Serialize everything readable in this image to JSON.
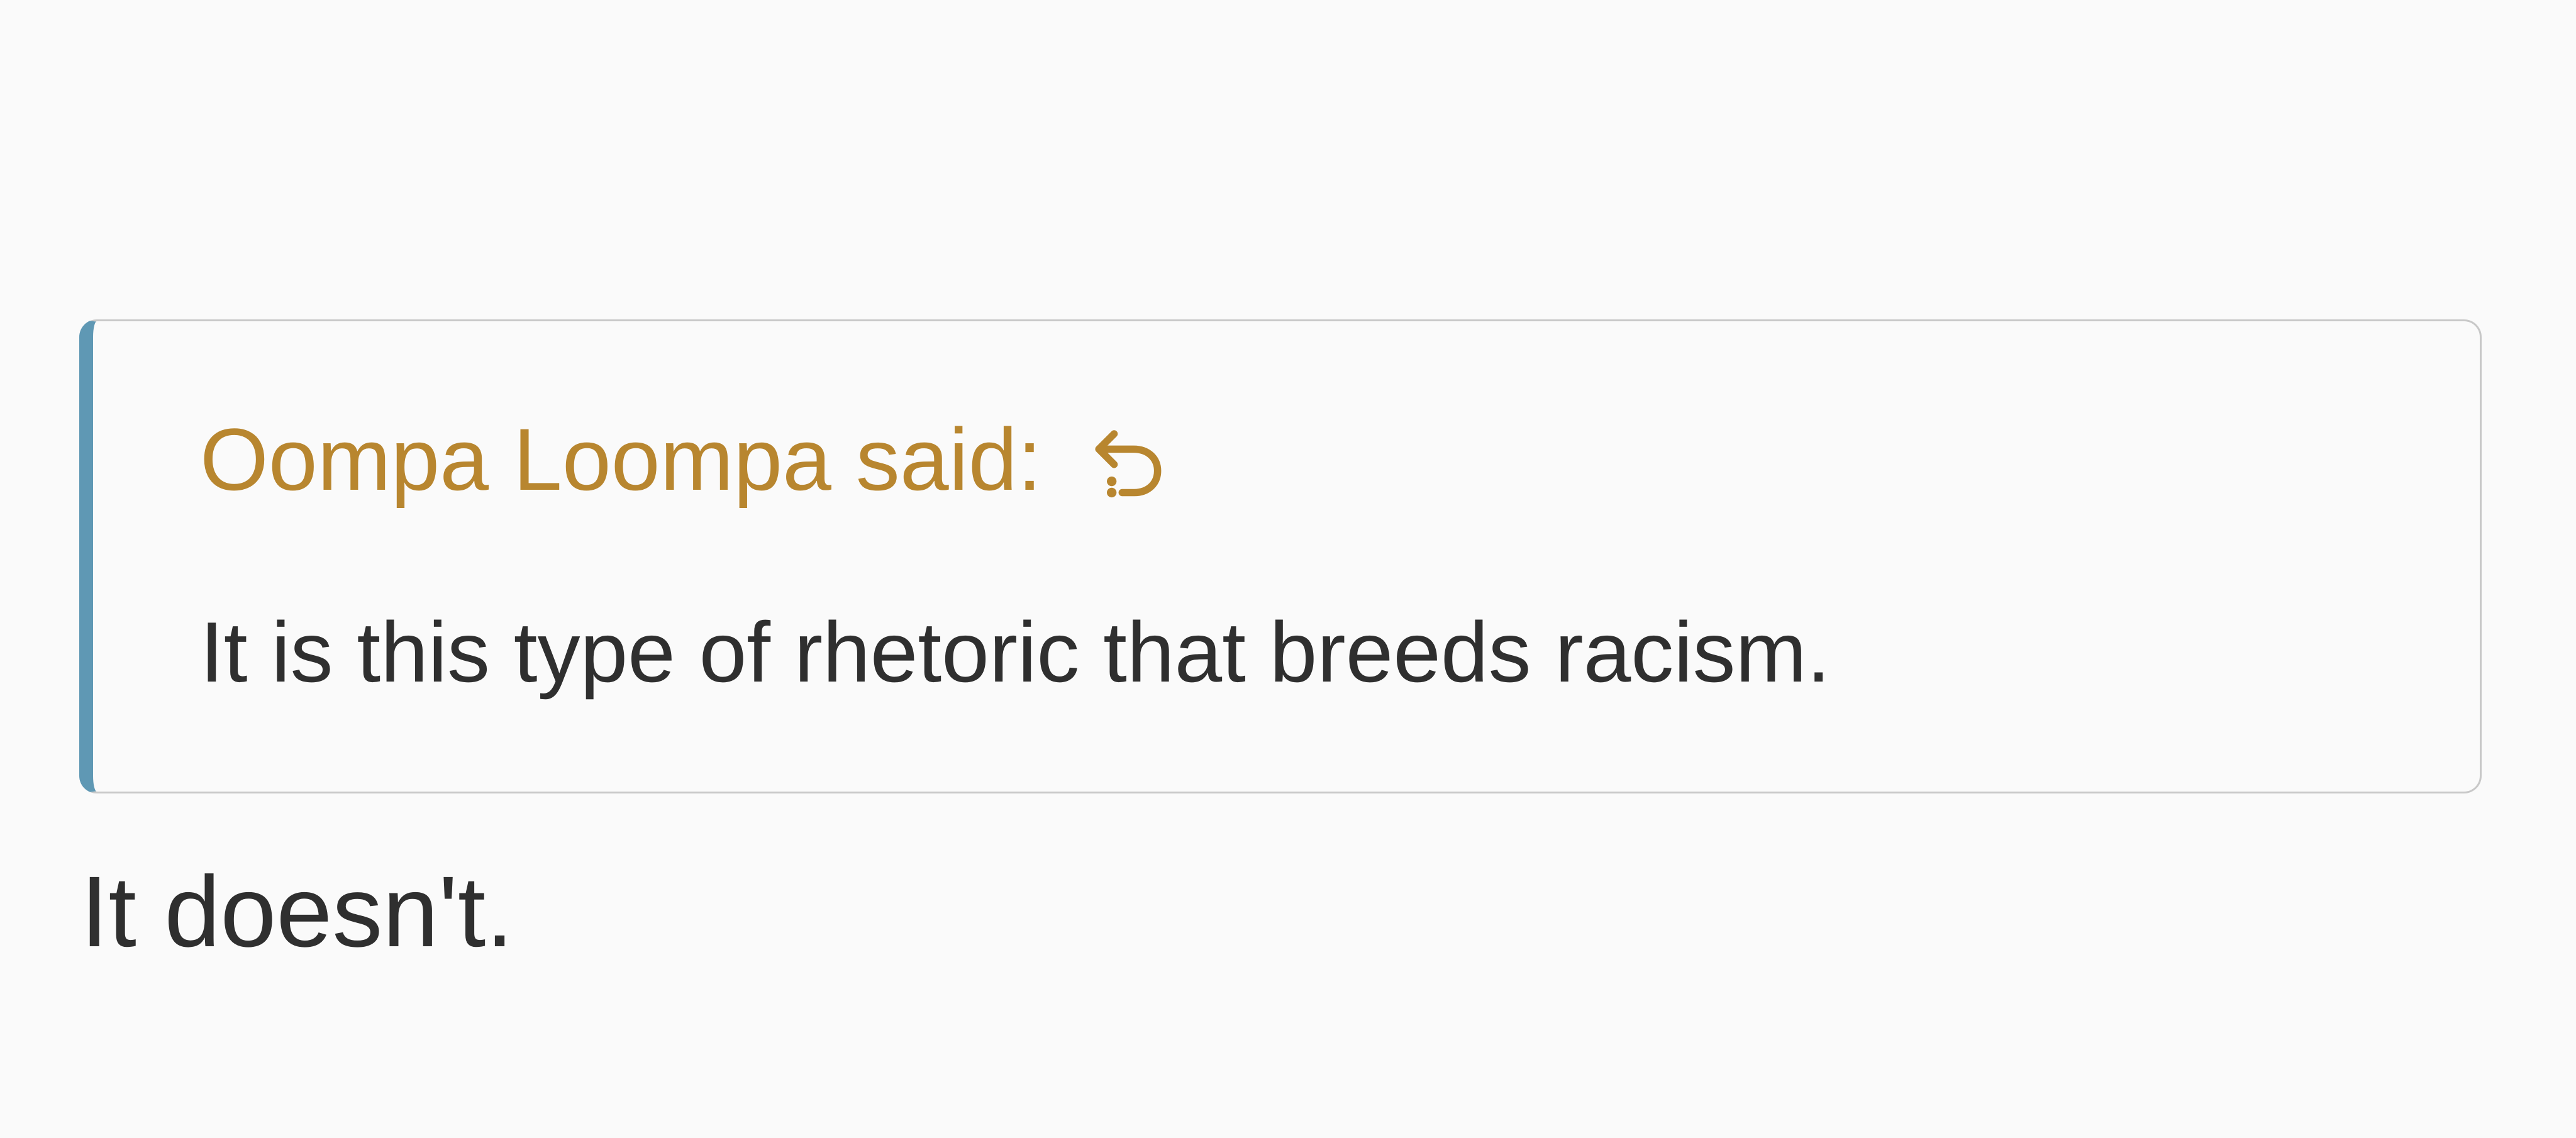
{
  "quote": {
    "author_line": "Oompa Loompa said:",
    "text": "It is this type of rhetoric that breeds racism.",
    "icon": "jump-to-quote-icon",
    "accent_color": "#b8862f",
    "border_accent_color": "#5f98b4"
  },
  "reply": {
    "text": "It doesn't."
  }
}
